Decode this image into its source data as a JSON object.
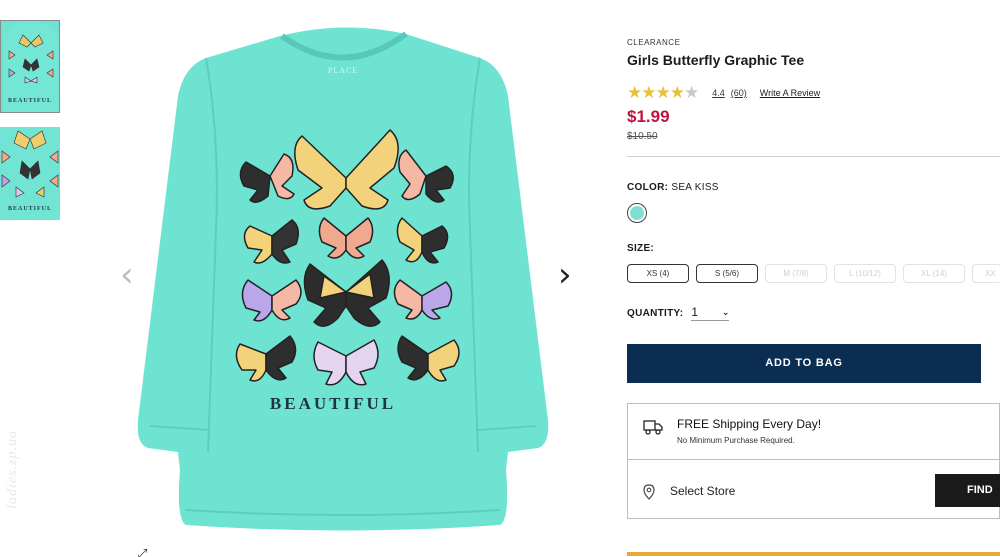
{
  "product": {
    "tag": "CLEARANCE",
    "title": "Girls Butterfly Graphic Tee",
    "rating": "4.4",
    "rating_value": 4.4,
    "review_count": "(60)",
    "write_review": "Write A Review",
    "price": "$1.99",
    "original_price": "$10.50"
  },
  "image": {
    "shirt_text": "BEAUTIFUL",
    "brand_text": "PLACE",
    "thumb_text": "BEAUTIFUL",
    "watermark": "ladies.zp.ua",
    "prev_arrow": "‹",
    "next_arrow": "›",
    "zoom_icon": "⤢",
    "shirt_color": "#6fe3d2"
  },
  "color": {
    "label": "COLOR:",
    "value": "SEA KISS",
    "swatch_hex": "#7fe0d1"
  },
  "size": {
    "label": "SIZE:",
    "options": [
      {
        "label": "XS (4)",
        "available": true
      },
      {
        "label": "S (5/6)",
        "available": true
      },
      {
        "label": "M (7/8)",
        "available": false
      },
      {
        "label": "L (10/12)",
        "available": false
      },
      {
        "label": "XL (14)",
        "available": false
      },
      {
        "label": "XX",
        "available": false
      }
    ]
  },
  "quantity": {
    "label": "QUANTITY:",
    "value": "1"
  },
  "add_to_bag": "ADD TO BAG",
  "shipping": {
    "title": "FREE Shipping Every Day!",
    "subtitle": "No Minimum Purchase Required.",
    "store_label": "Select Store",
    "find_button": "FIND"
  },
  "colors": {
    "price": "#c4123f",
    "button": "#0b2d52",
    "star": "#e9c03a",
    "accent_bar": "#e7a93b"
  }
}
